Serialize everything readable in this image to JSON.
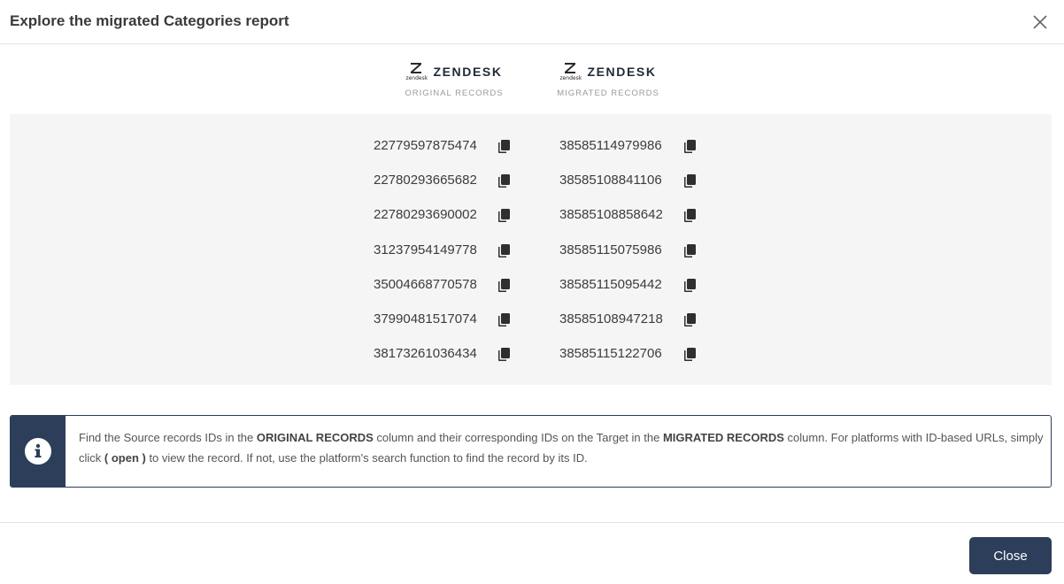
{
  "header": {
    "title": "Explore the migrated Categories report"
  },
  "columns": {
    "source": {
      "brand_word": "ZENDESK",
      "brand_small": "zendesk",
      "caption": "ORIGINAL RECORDS"
    },
    "target": {
      "brand_word": "ZENDESK",
      "brand_small": "zendesk",
      "caption": "MIGRATED RECORDS"
    }
  },
  "records": [
    {
      "source_id": "22779597875474",
      "target_id": "38585114979986"
    },
    {
      "source_id": "22780293665682",
      "target_id": "38585108841106"
    },
    {
      "source_id": "22780293690002",
      "target_id": "38585108858642"
    },
    {
      "source_id": "31237954149778",
      "target_id": "38585115075986"
    },
    {
      "source_id": "35004668770578",
      "target_id": "38585115095442"
    },
    {
      "source_id": "37990481517074",
      "target_id": "38585108947218"
    },
    {
      "source_id": "38173261036434",
      "target_id": "38585115122706"
    }
  ],
  "info": {
    "t1": "Find the Source records IDs in the ",
    "b1": "ORIGINAL RECORDS",
    "t2": " column and their corresponding IDs on the Target in the ",
    "b2": "MIGRATED RECORDS",
    "t3": " column. For platforms with ID-based URLs, simply click ",
    "b3": "( open )",
    "t4": " to view the record. If not, use the platform's search function to find the record by its ID."
  },
  "footer": {
    "close_label": "Close"
  },
  "icons": {
    "close": "close-icon",
    "copy": "copy-icon",
    "info": "info-icon",
    "logo": "zendesk-logo-icon"
  },
  "colors": {
    "accent": "#2c3e5a",
    "panel": "#f5f5f5"
  }
}
